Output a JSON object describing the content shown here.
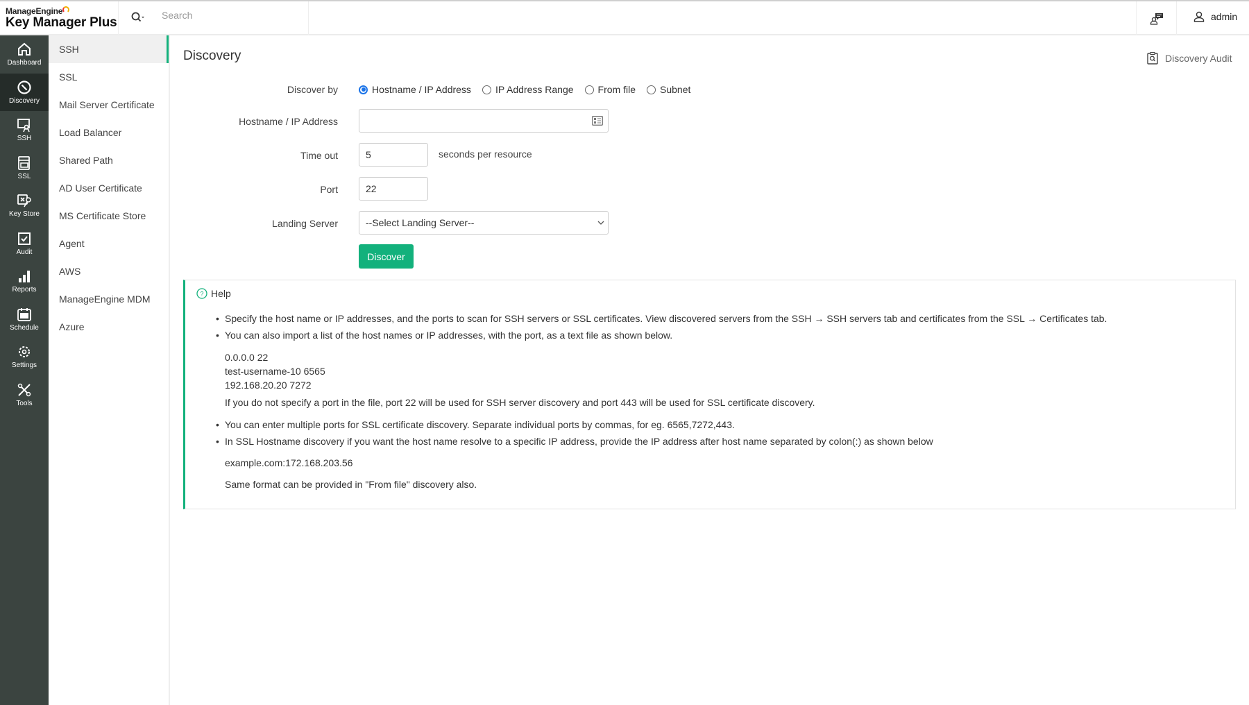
{
  "header": {
    "brand_small": "ManageEngine",
    "brand_large": "Key Manager Plus",
    "search_placeholder": "Search",
    "user": "admin"
  },
  "nav": [
    {
      "label": "Dashboard",
      "icon": "home-icon"
    },
    {
      "label": "Discovery",
      "icon": "compass-icon",
      "active": true
    },
    {
      "label": "SSH",
      "icon": "ssh-icon"
    },
    {
      "label": "SSL",
      "icon": "ssl-icon"
    },
    {
      "label": "Key Store",
      "icon": "key-store-icon"
    },
    {
      "label": "Audit",
      "icon": "audit-icon"
    },
    {
      "label": "Reports",
      "icon": "reports-icon"
    },
    {
      "label": "Schedule",
      "icon": "calendar-icon"
    },
    {
      "label": "Settings",
      "icon": "gear-icon"
    },
    {
      "label": "Tools",
      "icon": "tools-icon"
    }
  ],
  "submenu": [
    {
      "label": "SSH",
      "active": true
    },
    {
      "label": "SSL"
    },
    {
      "label": "Mail Server Certificate"
    },
    {
      "label": "Load Balancer"
    },
    {
      "label": "Shared Path"
    },
    {
      "label": "AD User Certificate"
    },
    {
      "label": "MS Certificate Store"
    },
    {
      "label": "Agent"
    },
    {
      "label": "AWS"
    },
    {
      "label": "ManageEngine MDM"
    },
    {
      "label": "Azure"
    }
  ],
  "page": {
    "title": "Discovery",
    "audit_link": "Discovery Audit"
  },
  "form": {
    "discover_by_label": "Discover by",
    "discover_by_options": [
      "Hostname / IP Address",
      "IP Address Range",
      "From file",
      "Subnet"
    ],
    "discover_by_selected": "Hostname / IP Address",
    "hostname_label": "Hostname / IP Address",
    "hostname_value": "",
    "timeout_label": "Time out",
    "timeout_value": "5",
    "timeout_hint": "seconds per resource",
    "port_label": "Port",
    "port_value": "22",
    "landing_label": "Landing Server",
    "landing_value": "--Select Landing Server--",
    "discover_button": "Discover"
  },
  "help": {
    "title": "Help",
    "lines": [
      "Specify the host name or IP addresses, and the ports to scan for SSH servers or SSL certificates. View discovered servers from the SSH → SSH servers tab and certificates from the SSL → Certificates tab.",
      "You can also import a list of the host names or IP addresses, with the port, as a text file as shown below.",
      "0.0.0.0 22",
      "test-username-10 6565",
      "192.168.20.20 7272",
      "If you do not specify a port in the file, port 22 will be used for SSH server discovery and port 443 will be used for SSL certificate discovery.",
      "You can enter multiple ports for SSL certificate discovery. Separate individual ports by commas, for eg. 6565,7272,443.",
      "In SSL Hostname discovery if you want the host name resolve to a specific IP address, provide the IP address after host name separated by colon(:) as shown below",
      "example.com:172.168.203.56",
      "Same format can be provided in \"From file\" discovery also."
    ]
  },
  "colors": {
    "accent": "#13b17c",
    "nav_bg": "#3b4440",
    "nav_active": "#252c29",
    "radio": "#1a73e8"
  }
}
